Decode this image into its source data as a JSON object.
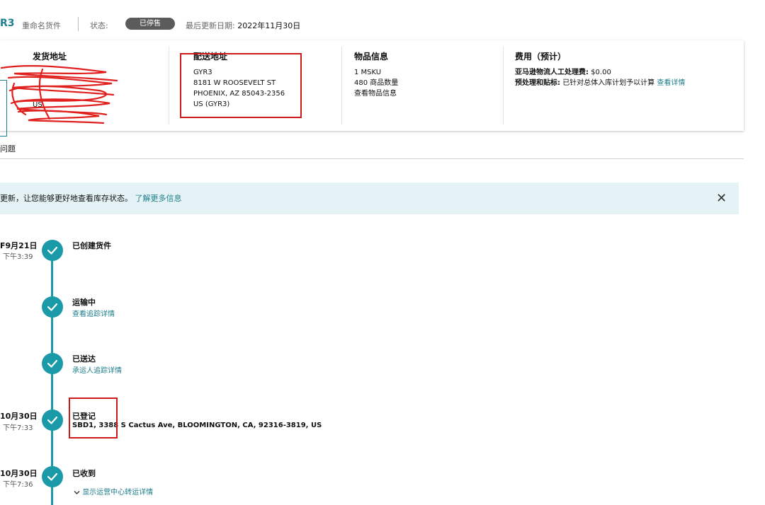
{
  "header": {
    "shipment_id_suffix": "R3",
    "rename_label": "重命名货件",
    "status_label": "状态:",
    "status_value": "已停售",
    "last_updated_label": "最后更新日期:",
    "last_updated_value": "2022年11月30日"
  },
  "card": {
    "ship_from": {
      "title": "发货地址",
      "lines": [
        "US"
      ]
    },
    "ship_to": {
      "title": "配送地址",
      "lines": [
        "GYR3",
        "8181 W ROOSEVELT ST",
        "PHOENIX, AZ 85043-2356",
        "US (GYR3)"
      ]
    },
    "contents": {
      "title": "物品信息",
      "msku": "1 MSKU",
      "units": "480 商品数量",
      "view_link": "查看物品信息"
    },
    "fees": {
      "title": "费用（预计）",
      "manual_label": "亚马逊物流人工处理费:",
      "manual_value": "$0.00",
      "prep_label": "预处理和贴标:",
      "prep_value": "已针对总体入库计划予以计算",
      "prep_link": "查看详情"
    }
  },
  "problem_text": "问题",
  "banner": {
    "text": "更新，让您能够更好地查看库存状态。",
    "link": "了解更多信息",
    "close_glyph": "✕"
  },
  "timeline": [
    {
      "date": "F9月21日",
      "time": "下午3:39",
      "title": "已创建货件",
      "sub": ""
    },
    {
      "date": "",
      "time": "",
      "title": "运输中",
      "sub": "查看追踪详情"
    },
    {
      "date": "",
      "time": "",
      "title": "已送达",
      "sub": "承运人追踪详情"
    },
    {
      "date": "10月30日",
      "time": "下午7:33",
      "title": "已登记",
      "sub": "SBD1, 3388 S Cactus Ave, BLOOMINGTON, CA, 92316-3819, US"
    },
    {
      "date": "10月30日",
      "time": "下午7:36",
      "title": "已收到",
      "sub": "显示运营中心转运详情"
    }
  ],
  "colors": {
    "accent": "#1a9aa9",
    "link": "#1c7d8a",
    "highlight_box": "#cc1a1a",
    "banner_bg": "#e6f3f6"
  }
}
